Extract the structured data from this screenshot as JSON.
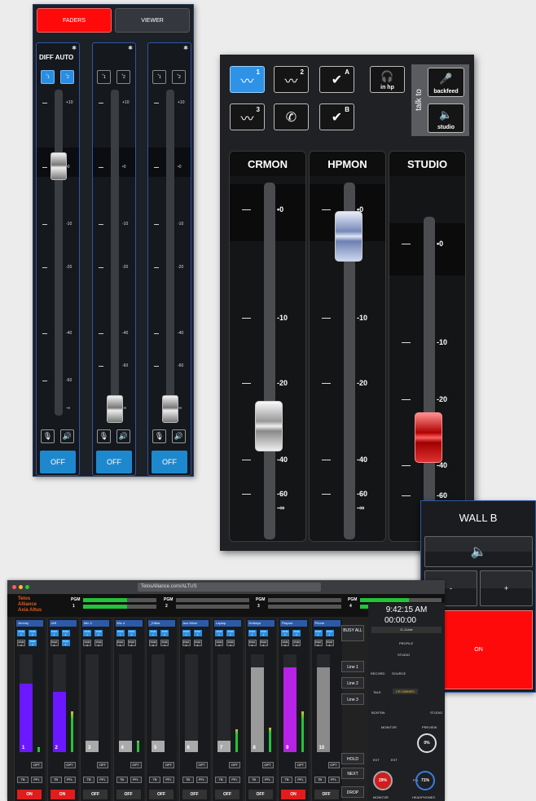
{
  "panel1": {
    "tabs": {
      "faders": "FADERS",
      "viewer": "VIEWER"
    },
    "strip1_name": "DIFF AUTO",
    "scale": [
      "+10",
      "•0",
      "-10",
      "-20",
      "-40",
      "-60",
      "-∞"
    ],
    "off_label": "OFF",
    "pgm_subscripts": [
      "1",
      "2"
    ],
    "fader_levels_db": [
      0,
      "-inf",
      "-inf"
    ]
  },
  "panel2": {
    "buttons": {
      "pgm1": "1",
      "pgm2": "2",
      "pgm3": "3",
      "check_a": "A",
      "check_b": "B",
      "in_hp": "in hp",
      "backfeed": "backfeed",
      "studio_btn": "studio",
      "talk_to": "talk to"
    },
    "channels": [
      {
        "name": "CRMON",
        "scale": [
          "•0",
          "-10",
          "-20",
          "-40",
          "-60",
          "-∞"
        ],
        "level_db": -30
      },
      {
        "name": "HPMON",
        "scale": [
          "•0",
          "-10",
          "-20",
          "-40",
          "-60",
          "-∞"
        ],
        "level_db": 0
      },
      {
        "name": "STUDIO",
        "scale": [
          "•0",
          "-10",
          "-20",
          "-40",
          "-60"
        ],
        "level_db": -25
      }
    ],
    "colors": {
      "active_blue": "#2e93e6",
      "crmon_cap": "#9a9a9a",
      "hpmon_cap": "#7588b9",
      "studio_cap": "#c00000"
    }
  },
  "panel3": {
    "title": "WALL B",
    "minus": "-",
    "plus": "+",
    "on": "ON",
    "on_color": "#ff0a0a"
  },
  "panel4": {
    "url": "TelosAlliance.com/ALTUS",
    "brand1": "Telos",
    "brand2": "Alliance",
    "brand3": "Axia Altus",
    "pgm": "PGM",
    "pgm_nums": [
      "1",
      "2",
      "3",
      "4"
    ],
    "channels": [
      {
        "name": "Jeremy",
        "num": "1",
        "on": "ON",
        "on_state": true
      },
      {
        "name": "Jeff",
        "num": "2",
        "on": "ON",
        "on_state": true
      },
      {
        "name": "Mic 3",
        "num": "3",
        "on": "OFF",
        "on_state": false
      },
      {
        "name": "Mic 4",
        "num": "4",
        "on": "OFF",
        "on_state": false
      },
      {
        "name": "_Editor",
        "num": "5",
        "on": "OFF",
        "on_state": false
      },
      {
        "name": "Aux Mixer",
        "num": "6",
        "on": "OFF",
        "on_state": false
      },
      {
        "name": "Laptop",
        "num": "7",
        "on": "OFF",
        "on_state": false
      },
      {
        "name": "Hotkeys",
        "num": "8",
        "on": "OFF",
        "on_state": false
      },
      {
        "name": "Playout",
        "num": "9",
        "on": "ON",
        "on_state": true
      },
      {
        "name": "Phone",
        "num": "10",
        "on": "OFF",
        "on_state": false
      }
    ],
    "opt": "OPT",
    "tb": "TB",
    "pfl": "PFL",
    "side_buttons": {
      "busy": "BUSY ALL",
      "line1": "Line 1",
      "line2": "Line 2",
      "line3": "Line 3",
      "hold": "HOLD",
      "next": "NEXT",
      "drop": "DROP"
    },
    "clock": "9:42:15 AM",
    "timer": "00:00:00",
    "profile_name": "C-J-Live",
    "profile_label": "PROFILE",
    "record": "RECORD",
    "source": "SOURCE",
    "studio": "STUDIO",
    "talk": "TALK",
    "cr_dimmed": "CR DIMMED",
    "monitor": "MONITOR",
    "preview": "PREVIEW",
    "ext": "EXT",
    "percent_preview": "0%",
    "percent_monitor": "29%",
    "percent_headphones": "71%",
    "headphones": "HEADPHONES",
    "bckfdn": "BCKFDN"
  }
}
